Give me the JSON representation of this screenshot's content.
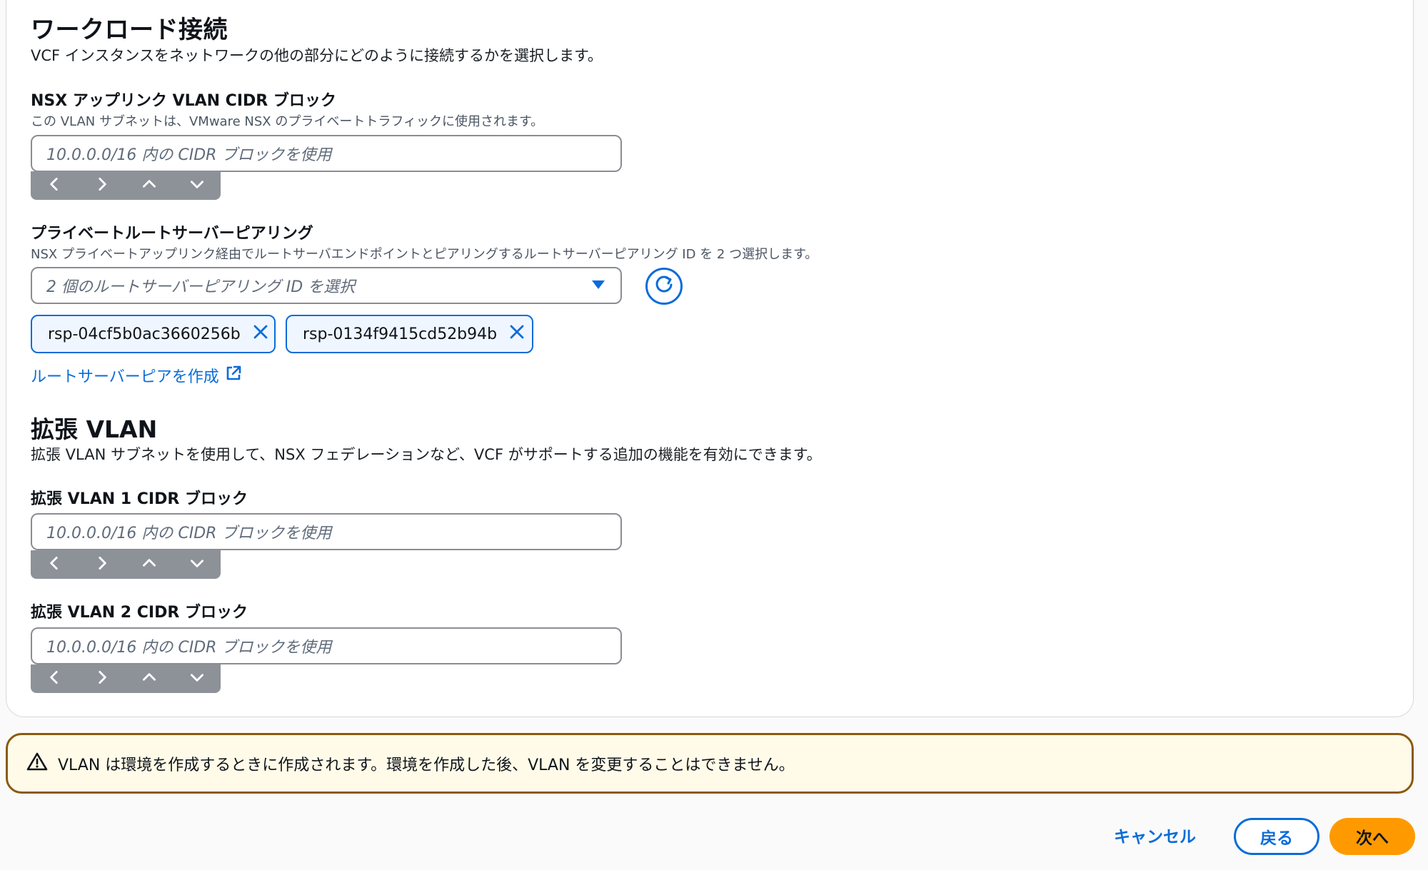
{
  "workload": {
    "title": "ワークロード接続",
    "description": "VCF インスタンスをネットワークの他の部分にどのように接続するかを選択します。"
  },
  "nsx_uplink": {
    "label": "NSX アップリンク VLAN CIDR ブロック",
    "sublabel": "この VLAN サブネットは、VMware NSX のプライベートトラフィックに使用されます。",
    "placeholder": "10.0.0.0/16 内の CIDR ブロックを使用"
  },
  "route_peering": {
    "label": "プライベートルートサーバーピアリング",
    "sublabel": "NSX プライベートアップリンク経由でルートサーバエンドポイントとピアリングするルートサーバーピアリング ID を 2 つ選択します。",
    "placeholder": "2 個のルートサーバーピアリング ID を選択",
    "tokens": [
      "rsp-04cf5b0ac3660256b",
      "rsp-0134f9415cd52b94b"
    ],
    "create_link": "ルートサーバーピアを作成"
  },
  "extended": {
    "title": "拡張 VLAN",
    "description": "拡張 VLAN サブネットを使用して、NSX フェデレーションなど、VCF がサポートする追加の機能を有効にできます。",
    "vlan1_label": "拡張 VLAN 1 CIDR ブロック",
    "vlan1_placeholder": "10.0.0.0/16 内の CIDR ブロックを使用",
    "vlan2_label": "拡張 VLAN 2 CIDR ブロック",
    "vlan2_placeholder": "10.0.0.0/16 内の CIDR ブロックを使用"
  },
  "alert": {
    "text": "VLAN は環境を作成するときに作成されます。環境を作成した後、VLAN を変更することはできません。"
  },
  "footer": {
    "cancel": "キャンセル",
    "back": "戻る",
    "next": "次へ"
  },
  "colors": {
    "link": "#0a6cd9",
    "primary_button": "#ff9900",
    "warning_border": "#8a5a0e"
  }
}
